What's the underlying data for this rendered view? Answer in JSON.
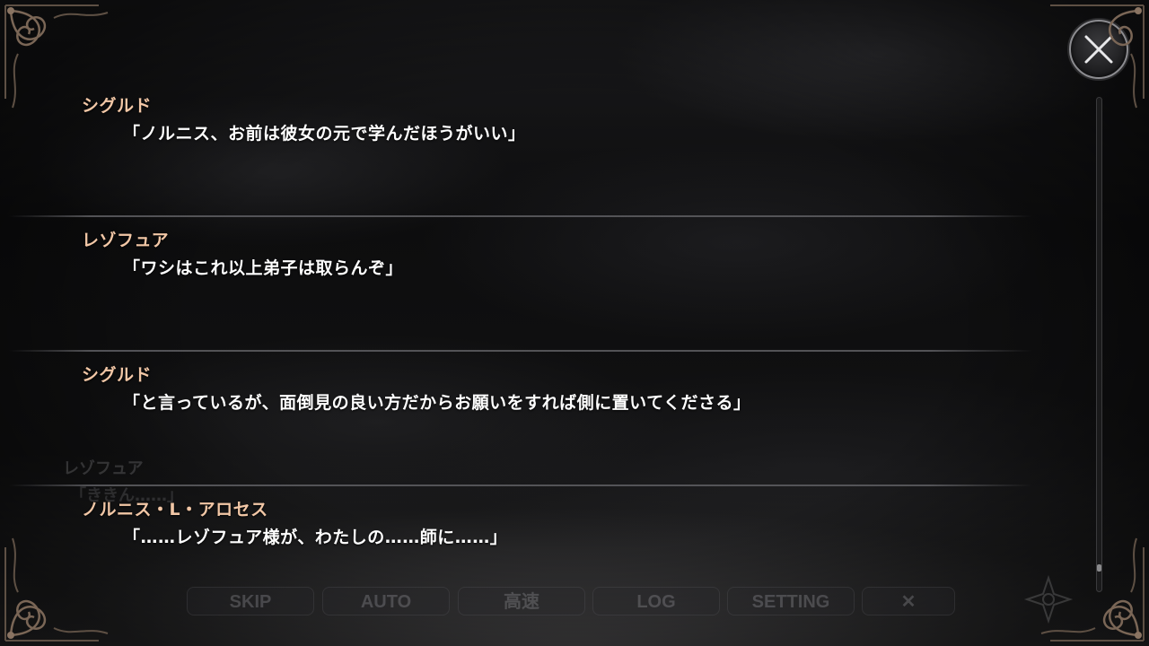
{
  "backlog": {
    "entries": [
      {
        "speaker": "シグルド",
        "line": "「ノルニス、お前は彼女の元で学んだほうがいい」"
      },
      {
        "speaker": "レゾフュア",
        "line": "「ワシはこれ以上弟子は取らんぞ」"
      },
      {
        "speaker": "シグルド",
        "line": "「と言っているが、面倒見の良い方だからお願いをすれば側に置いてくださる」"
      },
      {
        "speaker": "ノルニス・L・アロセス",
        "line": "「……レゾフュア様が、わたしの……師に……」"
      }
    ],
    "scroll_position": 0.96
  },
  "background_scene": {
    "speaker": "レゾフュア",
    "line": "「ききん……」"
  },
  "menu": {
    "skip": "SKIP",
    "auto": "AUTO",
    "fast": "高速",
    "log": "LOG",
    "setting": "SETTING",
    "close": "✕"
  },
  "colors": {
    "speaker_name": "#f2c7a6",
    "dialogue_text": "#ffffff",
    "frame": "#6a5a4a"
  },
  "icons": {
    "close_button": "close-icon",
    "corners": "ornate-frame-corner",
    "emblem": "emblem-icon"
  }
}
